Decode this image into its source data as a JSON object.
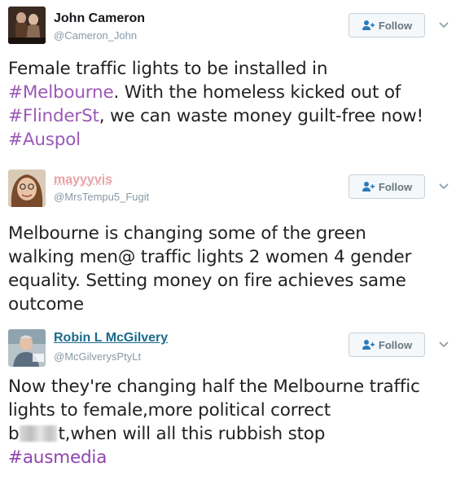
{
  "tweets": [
    {
      "display_name": "John Cameron",
      "handle": "@Cameron_John",
      "follow_label": "Follow",
      "text": {
        "l1": "Female traffic lights to be installed in",
        "l2_tag": "#Melbourne",
        "l2_rest": ". With the homeless kicked out of",
        "l3_tag": "#FlinderSt",
        "l3_rest": ", we can waste money guilt-free now!",
        "l4_tag": "#Auspol"
      }
    },
    {
      "display_name": "mayyyvis",
      "handle": "@MrsTempu5_Fugit",
      "follow_label": "Follow",
      "text": {
        "l1": "Melbourne is changing some of the green",
        "l2": "walking men@ traffic lights 2 women 4 gender",
        "l3": "equality. Setting money on fire achieves same",
        "l4": "outcome"
      }
    },
    {
      "display_name": "Robin L McGilvery",
      "handle": "@McGilverysPtyLt",
      "follow_label": "Follow",
      "text": {
        "l1": "Now they're changing half the Melbourne traffic",
        "l2": "lights to female,more political correct",
        "l3_start": "b",
        "l3_end": "t,when will all this rubbish stop",
        "l4_tag": "#ausmedia"
      }
    }
  ],
  "colors": {
    "hashtag": "#9b59b6",
    "handle": "#8899a6",
    "follow_text": "#66757f"
  },
  "icons": [
    "follow-person-icon",
    "chevron-down-icon"
  ]
}
